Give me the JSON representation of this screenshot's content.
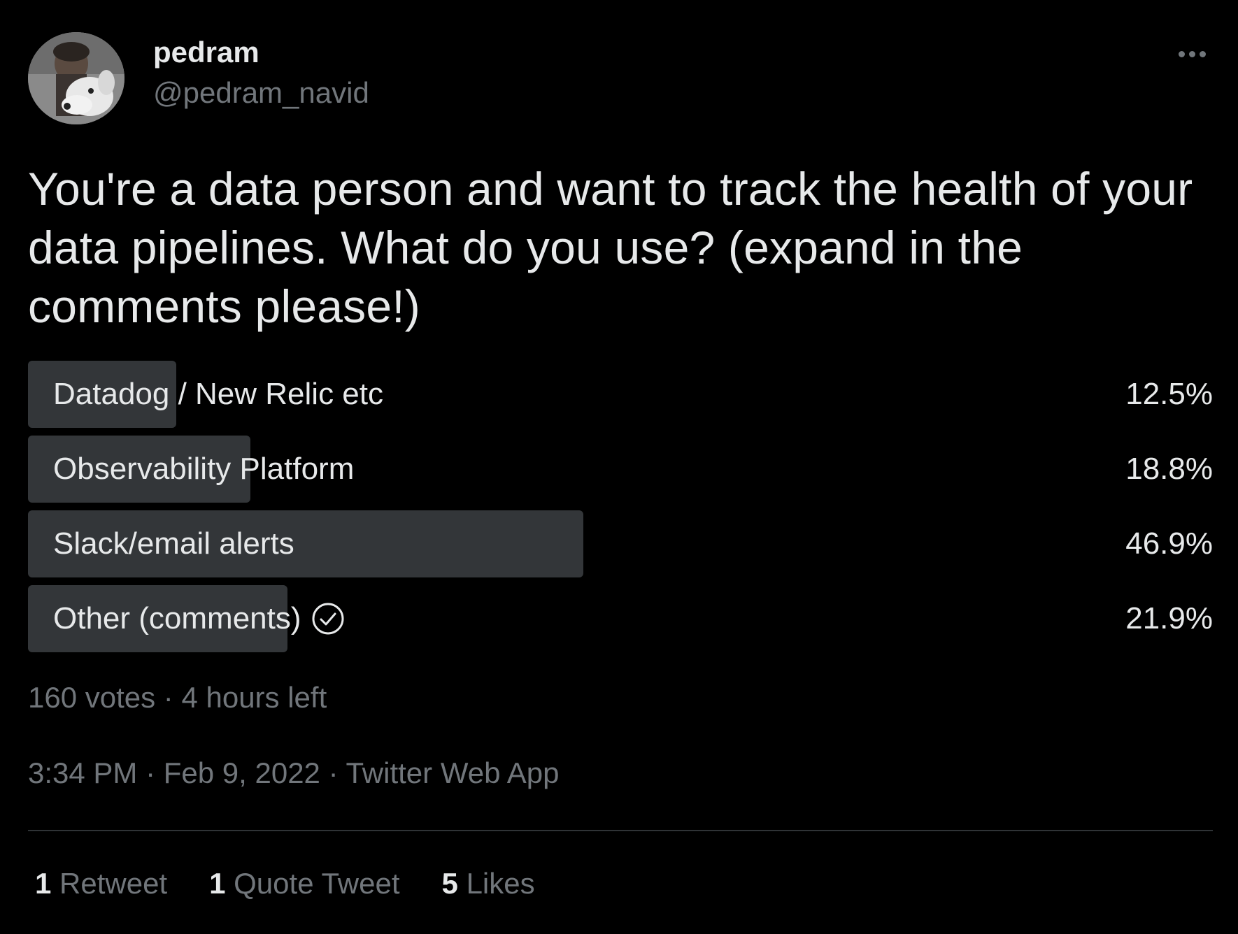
{
  "author": {
    "display_name": "pedram",
    "handle": "@pedram_navid"
  },
  "tweet": {
    "text": "You're a data person and want to track the health of your data pipelines. What do you use? (expand in the comments please!)"
  },
  "poll": {
    "options": [
      {
        "label": "Datadog / New Relic etc",
        "percent": "12.5%",
        "value": 12.5
      },
      {
        "label": "Observability Platform",
        "percent": "18.8%",
        "value": 18.8
      },
      {
        "label": "Slack/email alerts",
        "percent": "46.9%",
        "value": 46.9
      },
      {
        "label": "Other (comments)",
        "percent": "21.9%",
        "value": 21.9
      }
    ],
    "meta": "160 votes · 4 hours left"
  },
  "timestamp": "3:34 PM · Feb 9, 2022 · Twitter Web App",
  "stats": {
    "retweets_count": "1",
    "retweets_label": "Retweet",
    "quotes_count": "1",
    "quotes_label": "Quote Tweet",
    "likes_count": "5",
    "likes_label": "Likes"
  },
  "colors": {
    "background": "#000000",
    "text_primary": "#e7e9ea",
    "text_secondary": "#71767b",
    "poll_bar": "#333639",
    "divider": "#2f3336"
  },
  "icons": {
    "more": "more-horizontal-icon",
    "selected": "check-circle-icon"
  }
}
